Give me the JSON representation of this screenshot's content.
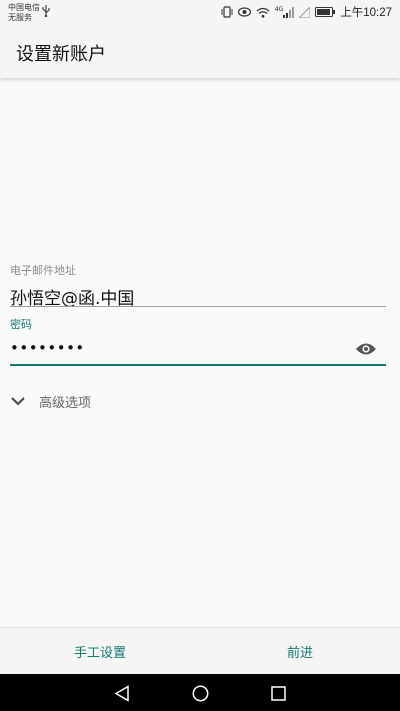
{
  "status_bar": {
    "carrier_line1": "中国电信",
    "carrier_line2": "无服务",
    "network_type": "4G",
    "clock": "上午10:27"
  },
  "app_bar": {
    "title": "设置新账户"
  },
  "form": {
    "email_label": "电子邮件地址",
    "email_value": "孙悟空@函.中国",
    "password_label": "密码",
    "password_value": "••••••••",
    "advanced_label": "高级选项"
  },
  "buttons": {
    "manual_setup": "手工设置",
    "next": "前进"
  },
  "colors": {
    "accent": "#0f7a6e"
  }
}
